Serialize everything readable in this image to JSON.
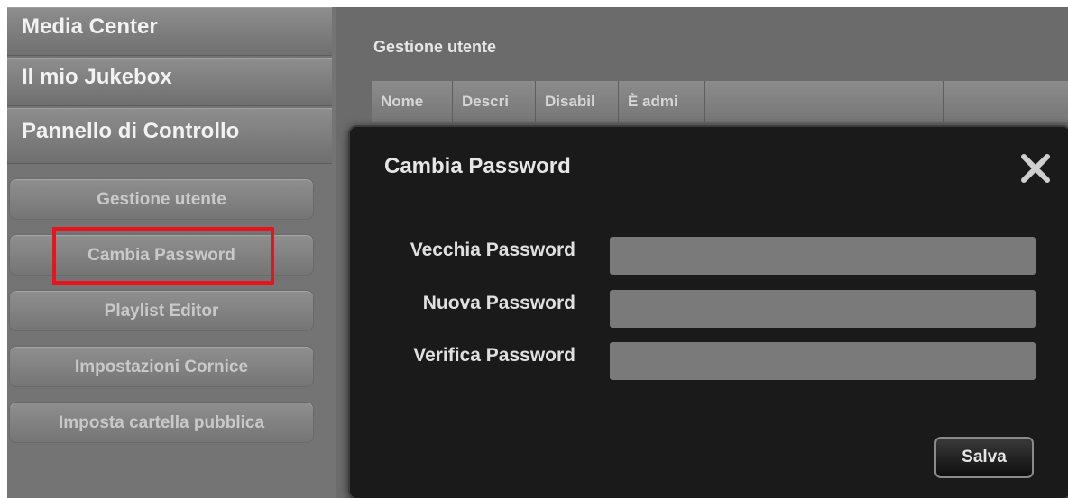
{
  "sidebar": {
    "headers": [
      "Media Center",
      "Il mio Jukebox",
      "Pannello di Controllo"
    ],
    "items": [
      {
        "label": "Gestione utente"
      },
      {
        "label": "Cambia Password"
      },
      {
        "label": "Playlist Editor"
      },
      {
        "label": "Impostazioni Cornice"
      },
      {
        "label": "Imposta cartella pubblica"
      }
    ],
    "highlight_color": "#e8131b"
  },
  "main": {
    "title": "Gestione utente",
    "columns": [
      "Nome",
      "Descri",
      "Disabil",
      "È admi"
    ]
  },
  "modal": {
    "title": "Cambia Password",
    "fields": [
      {
        "label": "Vecchia Password",
        "value": ""
      },
      {
        "label": "Nuova Password",
        "value": ""
      },
      {
        "label": "Verifica Password",
        "value": ""
      }
    ],
    "save_label": "Salva",
    "close_icon": "close-icon"
  }
}
